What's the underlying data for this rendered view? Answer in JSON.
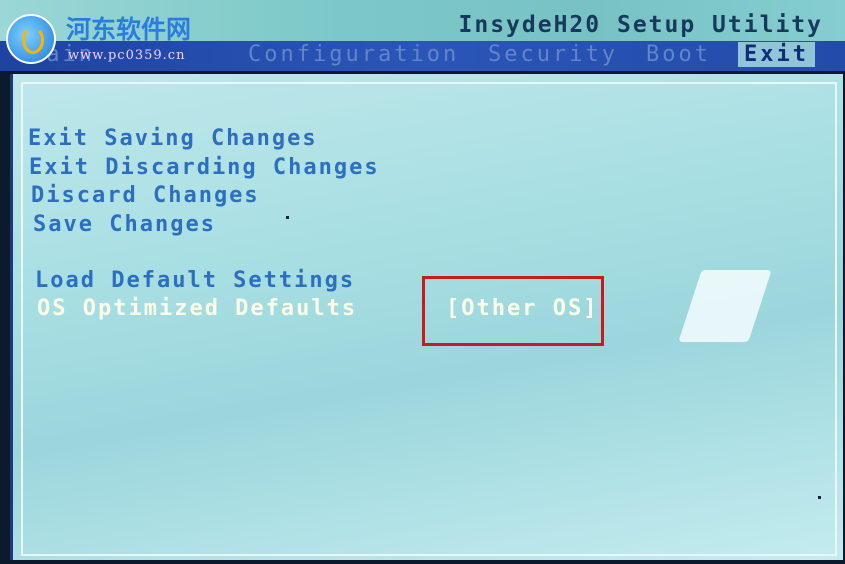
{
  "header": {
    "title": "InsydeH20 Setup Utility"
  },
  "menu": {
    "items": [
      {
        "label": "Main",
        "active": false
      },
      {
        "label": "Configuration",
        "active": false
      },
      {
        "label": "Security",
        "active": false
      },
      {
        "label": "Boot",
        "active": false
      },
      {
        "label": "Exit",
        "active": true
      }
    ]
  },
  "exit_menu": {
    "options": [
      {
        "label": "Exit Saving Changes"
      },
      {
        "label": "Exit Discarding Changes"
      },
      {
        "label": "Discard Changes"
      },
      {
        "label": "Save Changes"
      },
      {
        "label": "Load Default Settings"
      },
      {
        "label": "OS Optimized Defaults",
        "value": "[Other OS]",
        "selected": true
      }
    ]
  },
  "watermark": {
    "site_name": "河东软件网",
    "url": "www.pc0359.cn"
  },
  "colors": {
    "menu_bar": "#2a56b8",
    "option_text": "#2c6fc0",
    "selected_text": "#fbfde7",
    "highlight_box": "#cc1a1a"
  }
}
